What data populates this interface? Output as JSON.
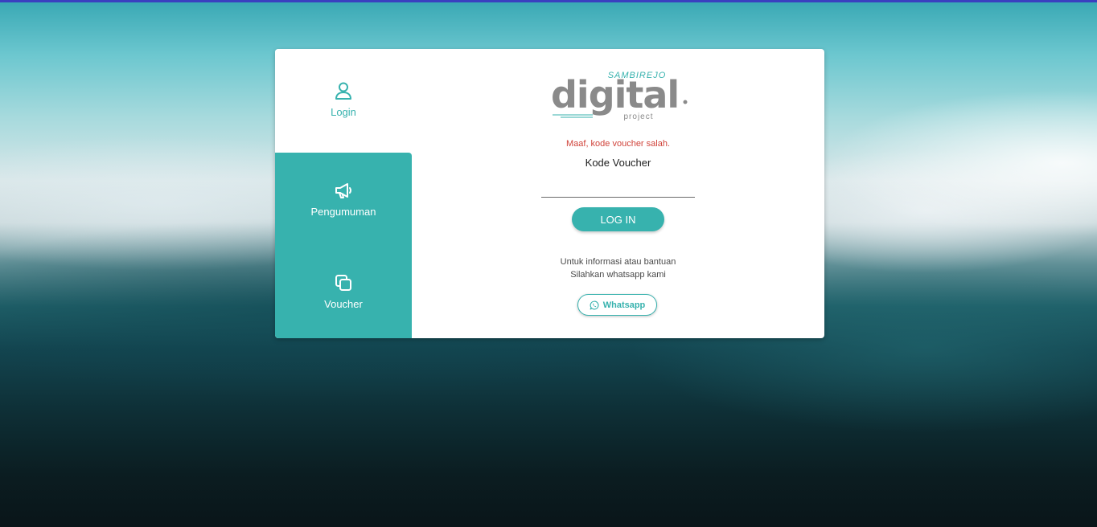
{
  "colors": {
    "accent": "#37b2ae",
    "error": "#d0433a",
    "top_bar": "#3a3fc0",
    "logo_gray": "#8a8a8a"
  },
  "sidebar": {
    "items": [
      {
        "label": "Login",
        "icon": "user-icon"
      },
      {
        "label": "Pengumuman",
        "icon": "megaphone-icon"
      },
      {
        "label": "Voucher",
        "icon": "copy-icon"
      }
    ]
  },
  "logo": {
    "top_text": "SAMBIREJO",
    "main_text": "digital",
    "bottom_text": "project"
  },
  "form": {
    "error_message": "Maaf, kode voucher salah.",
    "label": "Kode Voucher",
    "voucher_value": "",
    "voucher_placeholder": "",
    "submit_label": "LOG IN"
  },
  "help": {
    "line1": "Untuk informasi atau bantuan",
    "line2": "Silahkan whatsapp kami",
    "whatsapp_label": "Whatsapp",
    "whatsapp_icon": "whatsapp-icon"
  }
}
